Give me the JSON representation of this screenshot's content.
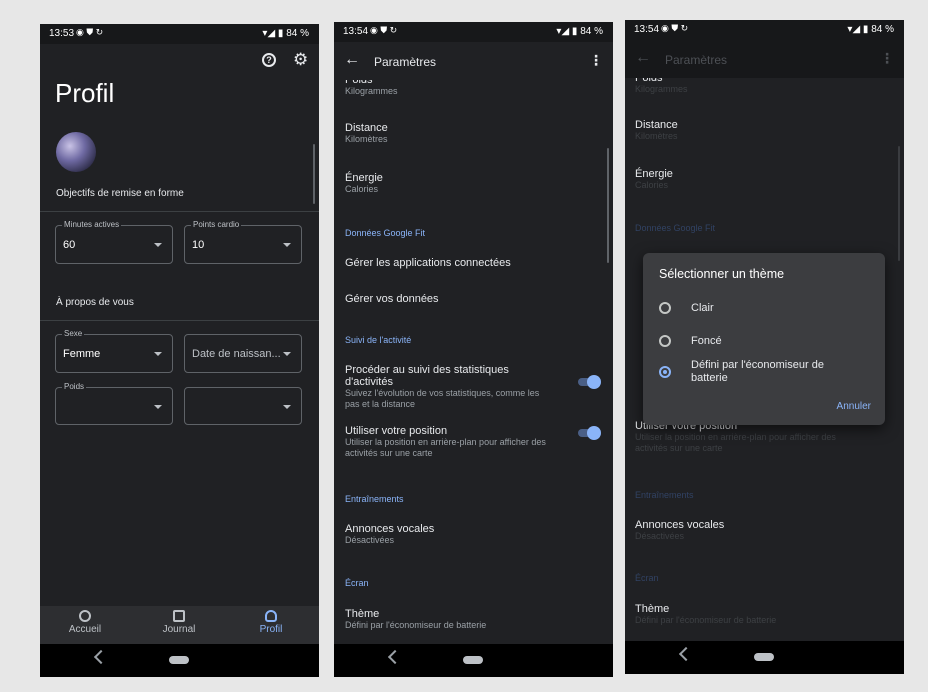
{
  "phone1": {
    "status": {
      "time": "13:53",
      "battery": "84 %"
    },
    "title": "Profil",
    "goals_heading": "Objectifs de remise en forme",
    "fields": {
      "minutes_label": "Minutes actives",
      "minutes_value": "60",
      "cardio_label": "Points cardio",
      "cardio_value": "10",
      "sexe_label": "Sexe",
      "sexe_value": "Femme",
      "birth_value": "Date de naissan...",
      "poids_label": "Poids"
    },
    "about_heading": "À propos de vous",
    "bottomnav": {
      "home": "Accueil",
      "journal": "Journal",
      "profil": "Profil"
    }
  },
  "phone2": {
    "status": {
      "time": "13:54",
      "battery": "84 %"
    },
    "appbar_title": "Paramètres",
    "poids_partial": "Poids",
    "poids_sub": "Kilogrammes",
    "distance": "Distance",
    "distance_sub": "Kilomètres",
    "energie": "Énergie",
    "energie_sub": "Calories",
    "section_fit": "Données Google Fit",
    "apps": "Gérer les applications connectées",
    "data": "Gérer vos données",
    "section_activity": "Suivi de l'activité",
    "track": "Procéder au suivi des statistiques d'activités",
    "track_sub": "Suivez l'évolution de vos statistiques, comme les pas et la distance",
    "position": "Utiliser votre position",
    "position_sub": "Utiliser la position en arrière-plan pour afficher des activités sur une carte",
    "section_train": "Entraînements",
    "voice": "Annonces vocales",
    "voice_sub": "Désactivées",
    "section_screen": "Écran",
    "theme": "Thème",
    "theme_sub": "Défini par l'économiseur de batterie"
  },
  "phone3": {
    "status": {
      "time": "13:54",
      "battery": "84 %"
    },
    "dialog": {
      "title": "Sélectionner un thème",
      "options": [
        "Clair",
        "Foncé",
        "Défini par l'économiseur de batterie"
      ],
      "selected_index": 2,
      "cancel": "Annuler"
    }
  },
  "colors": {
    "accent": "#8ab4f8",
    "background": "#202124"
  }
}
